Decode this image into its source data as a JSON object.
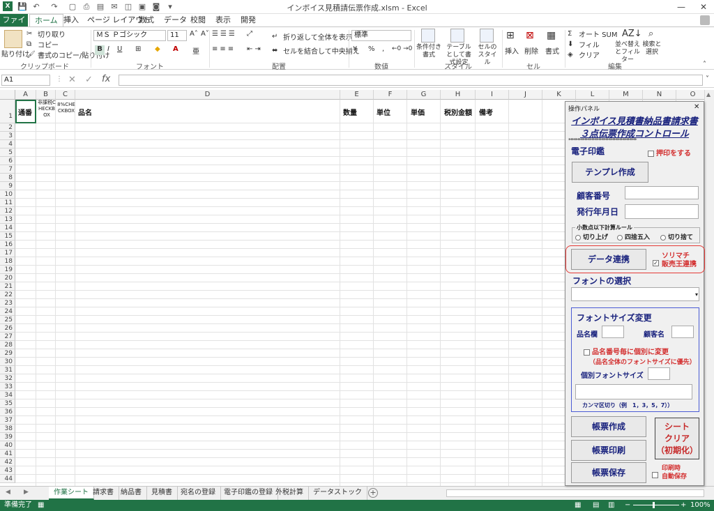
{
  "window": {
    "title": "インボイス見積請伝票作成.xlsm - Excel",
    "minimize": "—",
    "close": "✕"
  },
  "menu_tabs": [
    "ファイル",
    "ホーム",
    "挿入",
    "ページ レイアウト",
    "数式",
    "データ",
    "校閲",
    "表示",
    "開発"
  ],
  "ribbon": {
    "clipboard": {
      "paste": "貼り付け",
      "cut": "切り取り",
      "copy": "コピー",
      "format_painter": "書式のコピー/貼り付け",
      "label": "クリップボード"
    },
    "font": {
      "name": "ＭＳ Ｐゴシック",
      "size": "11",
      "bold": "B",
      "italic": "I",
      "underline": "U",
      "label": "フォント"
    },
    "alignment": {
      "wrap": "折り返して全体を表示する",
      "merge": "セルを結合して中央揃え",
      "label": "配置"
    },
    "number": {
      "format": "標準",
      "percent": "%",
      "comma": ",",
      "label": "数値"
    },
    "styles": {
      "cond": "条件付き書式",
      "table": "テーブルとして書式設定",
      "cell": "セルのスタイル",
      "label": "スタイル"
    },
    "cells": {
      "insert": "挿入",
      "delete": "削除",
      "format": "書式",
      "label": "セル"
    },
    "editing": {
      "autosum": "オート SUM",
      "fill": "フィル",
      "clear": "クリア",
      "sort": "並べ替えとフィルター",
      "find": "検索と選択",
      "label": "編集"
    }
  },
  "formula_bar": {
    "name_box": "A1",
    "fx": "fx",
    "value": ""
  },
  "columns": [
    "A",
    "B",
    "C",
    "D",
    "E",
    "F",
    "G",
    "H",
    "I",
    "J",
    "K",
    "L",
    "M",
    "N",
    "O"
  ],
  "header_row": {
    "A": "通番",
    "B": "非課税CHECKBOX",
    "C": "8%CHECKBOX",
    "D": "品名",
    "E": "数量",
    "F": "単位",
    "G": "単価",
    "H": "税別金額",
    "I": "備考"
  },
  "rows": [
    "1",
    "2",
    "3",
    "4",
    "5",
    "6",
    "7",
    "8",
    "9",
    "10",
    "11",
    "12",
    "13",
    "14",
    "15",
    "16",
    "17",
    "18",
    "19",
    "20",
    "21",
    "22",
    "23",
    "24",
    "25",
    "26",
    "27",
    "28",
    "29",
    "30",
    "31",
    "32",
    "33",
    "34",
    "35",
    "36",
    "37",
    "38",
    "39",
    "40",
    "41",
    "42",
    "43",
    "44"
  ],
  "sheet_tabs": [
    "作業シート",
    "請求書",
    "納品書",
    "見積書",
    "宛名の登録",
    "電子印鑑の登録",
    "外税計算",
    "データストック"
  ],
  "status": {
    "ready": "準備完了",
    "zoom": "100%"
  },
  "panel": {
    "title": "操作パネル",
    "heading1": "インボイス見積書納品書請求書",
    "heading2": "３点伝票作成コントロール",
    "stars": "***************************************",
    "seal_label": "電子印鑑",
    "stamp_check": "押印をする",
    "template_btn": "テンプレ作成",
    "customer_no": "顧客番号",
    "issue_date": "発行年月日",
    "rounding_legend": "小数点以下計算ルール",
    "round_up": "切り上げ",
    "round_half": "四捨五入",
    "round_down": "切り捨て",
    "data_link_btn": "データ連携",
    "sorimachi1": "ソリマチ",
    "sorimachi2": "販売王連携",
    "font_select": "フォントの選択",
    "font_size_change": "フォントサイズ変更",
    "item_col": "品名欄",
    "customer_name": "顧客名",
    "per_item": "品名番号毎に個別に変更",
    "priority_note": "（品名全体のフォントサイズに優先）",
    "indiv_size": "個別フォントサイズ",
    "comma_note": "カンマ区切り（例　1，3，5，7））",
    "create_btn": "帳票作成",
    "print_btn": "帳票印刷",
    "save_btn": "帳票保存",
    "clear_btn1": "シート",
    "clear_btn2": "クリア",
    "clear_btn3": "（初期化）",
    "autosave1": "印刷時",
    "autosave2": "自動保存",
    "close": "✕"
  }
}
